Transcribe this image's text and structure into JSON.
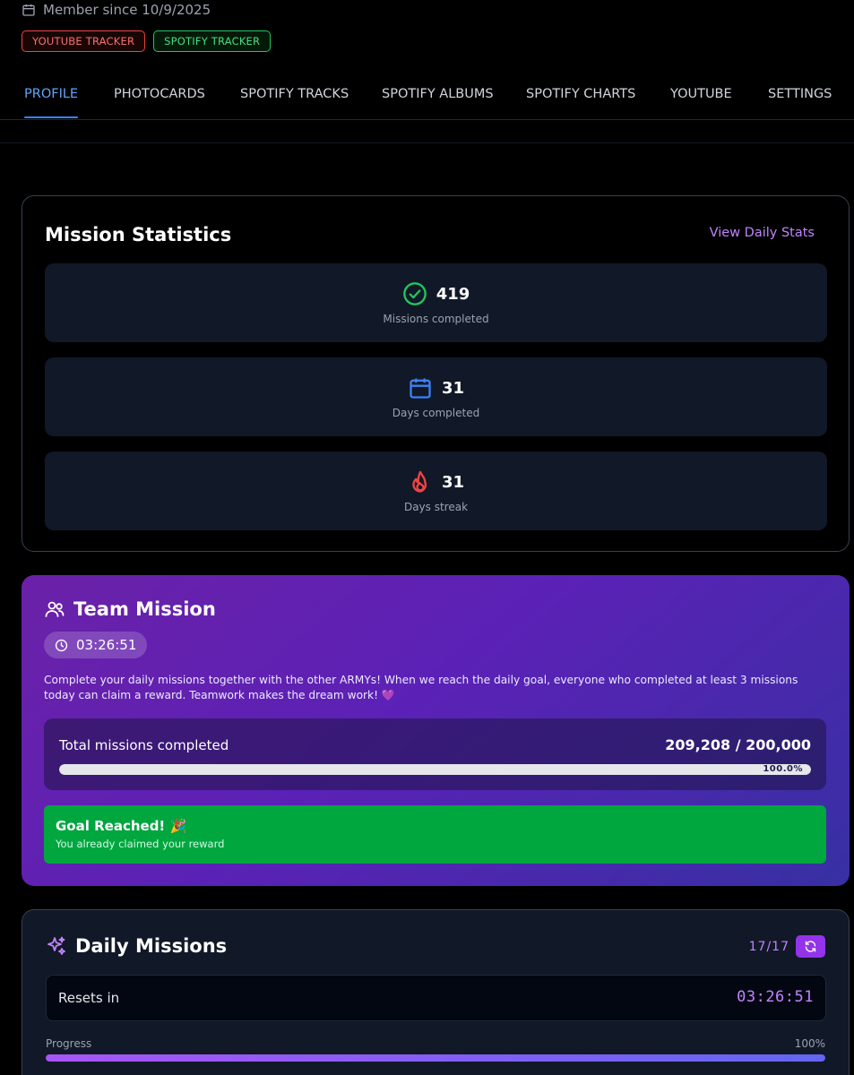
{
  "profile": {
    "member_since": "Member since 10/9/2025",
    "trackers": [
      "YOUTUBE TRACKER",
      "SPOTIFY TRACKER"
    ]
  },
  "nav": {
    "tabs": [
      "PROFILE",
      "PHOTOCARDS",
      "SPOTIFY TRACKS",
      "SPOTIFY ALBUMS",
      "SPOTIFY CHARTS",
      "YOUTUBE",
      "SETTINGS"
    ],
    "active": "PROFILE"
  },
  "mission_stats": {
    "title": "Mission Statistics",
    "link": "View Daily Stats",
    "items": [
      {
        "value": "419",
        "label": "Missions completed",
        "icon": "check-circle-icon",
        "color": "#22c55e"
      },
      {
        "value": "31",
        "label": "Days completed",
        "icon": "calendar-icon",
        "color": "#3b82f6"
      },
      {
        "value": "31",
        "label": "Days streak",
        "icon": "flame-icon",
        "color": "#ef4444"
      }
    ]
  },
  "team_mission": {
    "title": "Team Mission",
    "timer": "03:26:51",
    "description": "Complete your daily missions together with the other ARMYs! When we reach the daily goal, everyone who completed at least 3 missions today can claim a reward. Teamwork makes the dream work! 💜",
    "progress_label": "Total missions completed",
    "progress_count": "209,208 / 200,000",
    "progress_percent": "100.0%",
    "progress_fraction": 1.0,
    "goal_title": "Goal Reached! 🎉",
    "goal_subtitle": "You already claimed your reward"
  },
  "daily_missions": {
    "title": "Daily Missions",
    "count": "17/17",
    "reset_label": "Resets in",
    "reset_time": "03:26:51",
    "progress_label": "Progress",
    "progress_percent": "100%",
    "progress_fraction": 1.0
  }
}
